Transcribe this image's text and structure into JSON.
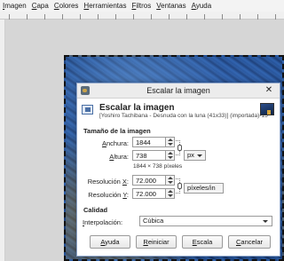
{
  "menubar": [
    {
      "label": "Imagen",
      "mnem": "I",
      "rest": "magen"
    },
    {
      "label": "Capa",
      "mnem": "C",
      "rest": "apa"
    },
    {
      "label": "Colores",
      "mnem": "C",
      "rest": "olores"
    },
    {
      "label": "Herramientas",
      "mnem": "H",
      "rest": "erramientas"
    },
    {
      "label": "Filtros",
      "mnem": "F",
      "rest": "iltros"
    },
    {
      "label": "Ventanas",
      "mnem": "V",
      "rest": "entanas"
    },
    {
      "label": "Ayuda",
      "mnem": "A",
      "rest": "yuda"
    }
  ],
  "dialog": {
    "title": "Escalar la imagen",
    "header_title": "Escalar la imagen",
    "header_subtitle": "[Yoshiro Tachibana - Desnuda con la luna (41x33)] (importada)-15",
    "close_symbol": "✕",
    "size_section": "Tamaño de la imagen",
    "width_label": {
      "mnem": "A",
      "rest": "nchura:"
    },
    "width_value": "1844",
    "height_label": {
      "mnem": "A",
      "rest": "ltura:"
    },
    "height_value": "738",
    "size_note": "1844 × 738 píxeles",
    "unit_value": "px",
    "res_x_label": {
      "pre": "Resolución ",
      "mnem": "X",
      "post": ":"
    },
    "res_x_value": "72.000",
    "res_y_label": {
      "pre": "Resolución ",
      "mnem": "Y",
      "post": ":"
    },
    "res_y_value": "72.000",
    "res_unit_value": "píxeles/in",
    "quality_section": "Calidad",
    "interp_label": {
      "mnem": "I",
      "rest": "nterpolación:"
    },
    "interp_value": "Cúbica",
    "buttons": {
      "help": {
        "mnem": "A",
        "rest": "yuda"
      },
      "reset": {
        "mnem": "R",
        "rest": "einiciar"
      },
      "scale": {
        "mnem": "E",
        "rest": "scala"
      },
      "cancel": {
        "mnem": "C",
        "rest": "ancelar"
      }
    }
  },
  "icons": [
    "app-icon",
    "scale-icon",
    "chain-icon",
    "close-icon",
    "chevron-down-icon"
  ]
}
